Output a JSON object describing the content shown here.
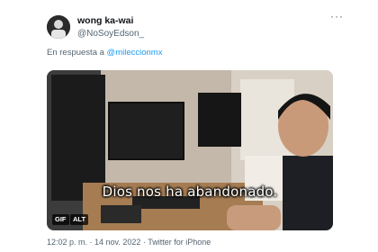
{
  "tweet": {
    "author": {
      "display_name": "wong ka-wai",
      "handle": "@NoSoyEdson_"
    },
    "reply_prefix": "En respuesta a",
    "reply_mention": "@mileccionmx",
    "media": {
      "caption": "Dios nos ha abandonado.",
      "gif_badge": "GIF",
      "alt_badge": "ALT"
    },
    "timestamp": "12:02 p. m. · 14 nov. 2022 · Twitter for iPhone",
    "more_icon": "more-horizontal-icon"
  },
  "colors": {
    "link": "#1d9bf0",
    "secondary_text": "#536471",
    "primary_text": "#0f1419"
  }
}
